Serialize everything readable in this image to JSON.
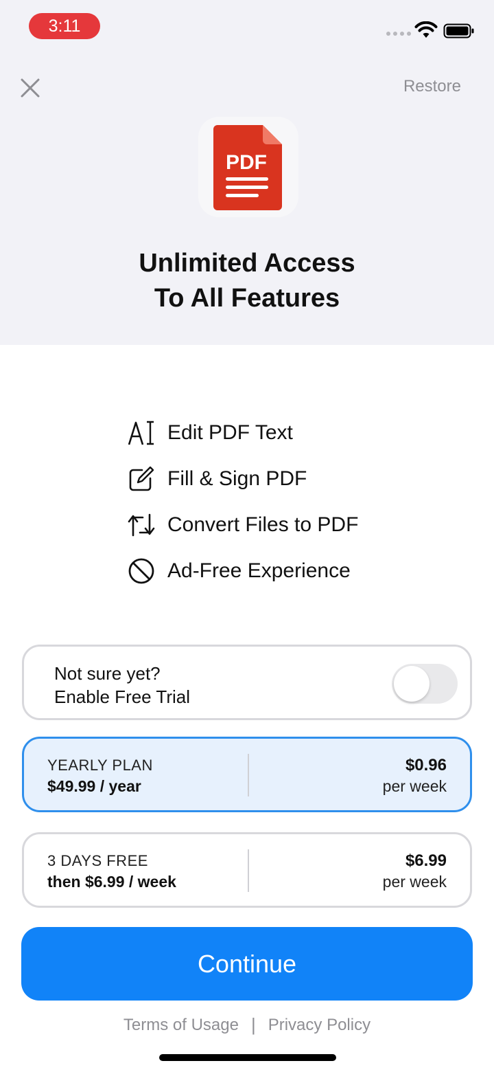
{
  "status_bar": {
    "time": "3:11"
  },
  "header": {
    "restore_label": "Restore"
  },
  "app_icon": {
    "text": "PDF"
  },
  "headline": {
    "line1": "Unlimited Access",
    "line2": "To All Features"
  },
  "features": [
    {
      "icon": "edit-text-icon",
      "label": "Edit PDF Text"
    },
    {
      "icon": "pencil-square-icon",
      "label": "Fill & Sign PDF"
    },
    {
      "icon": "convert-arrows-icon",
      "label": "Convert Files to PDF"
    },
    {
      "icon": "no-ads-icon",
      "label": "Ad-Free Experience"
    }
  ],
  "trial": {
    "line1": "Not sure yet?",
    "line2": "Enable Free Trial",
    "enabled": false
  },
  "plans": [
    {
      "name": "YEARLY PLAN",
      "price": "$49.99 / year",
      "rate": "$0.96",
      "unit": "per week",
      "selected": true
    },
    {
      "name": "3 DAYS FREE",
      "price": "then $6.99 / week",
      "rate": "$6.99",
      "unit": "per week",
      "selected": false
    }
  ],
  "continue_label": "Continue",
  "footer": {
    "terms": "Terms of Usage",
    "separator": "|",
    "privacy": "Privacy Policy"
  },
  "colors": {
    "accent": "#1183f8",
    "pdf_red": "#d9341f",
    "selected_bg": "#e7f1fd",
    "selected_border": "#2f8fec",
    "time_pill": "#e5383b"
  }
}
